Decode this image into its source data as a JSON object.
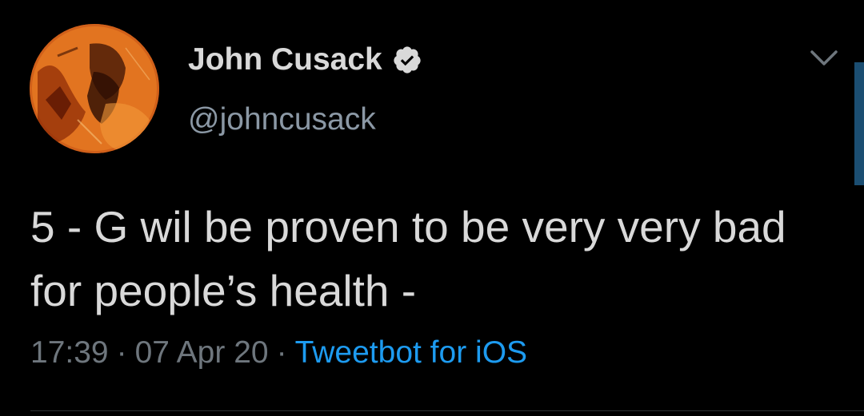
{
  "tweet": {
    "display_name": "John Cusack",
    "handle": "@johncusack",
    "text": "5 - G wil be proven to be very very bad for people’s health -",
    "time": "17:39",
    "date": "07 Apr 20",
    "separator": "·",
    "source": "Tweetbot for iOS"
  },
  "icons": {
    "verified": "verified-badge-icon",
    "menu": "chevron-down-icon",
    "avatar": "profile-avatar"
  },
  "colors": {
    "background": "#000000",
    "primary_text": "#d9d9d9",
    "secondary_text": "#8b98a5",
    "meta_text": "#6e767d",
    "link": "#1d9bf0",
    "avatar_orange": "#d4621a"
  }
}
